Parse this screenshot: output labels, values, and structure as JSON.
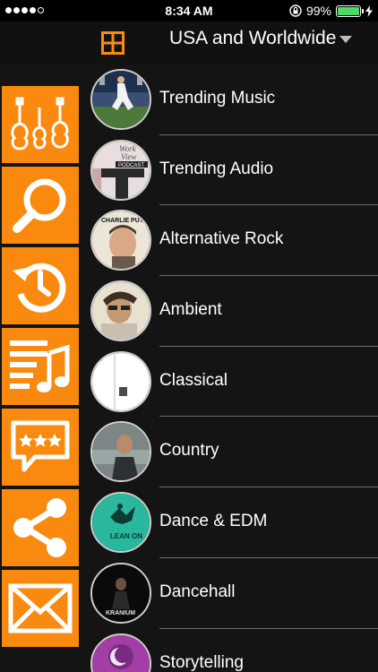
{
  "status_bar": {
    "time": "8:34 AM",
    "battery_percent": "99%",
    "battery_level": 0.99,
    "signal_bars_filled": 4,
    "signal_bars_total": 5
  },
  "header": {
    "region_label": "USA and Worldwide",
    "grid_icon": "grid-icon",
    "accent_color": "#f98a0f"
  },
  "sidebar": {
    "items": [
      {
        "icon": "guitars-icon",
        "name": "guitars"
      },
      {
        "icon": "search-icon",
        "name": "search"
      },
      {
        "icon": "history-icon",
        "name": "history"
      },
      {
        "icon": "playlist-icon",
        "name": "playlist"
      },
      {
        "icon": "rating-chat-icon",
        "name": "rate"
      },
      {
        "icon": "share-icon",
        "name": "share"
      },
      {
        "icon": "mail-icon",
        "name": "mail"
      }
    ]
  },
  "genres": [
    {
      "label": "Trending Music"
    },
    {
      "label": "Trending Audio",
      "thumb_text_1": "Work",
      "thumb_text_2": "View",
      "thumb_text_3": "PODCAST"
    },
    {
      "label": "Alternative Rock",
      "thumb_text_1": "CHARLIE PUTH"
    },
    {
      "label": "Ambient"
    },
    {
      "label": "Classical"
    },
    {
      "label": "Country"
    },
    {
      "label": "Dance & EDM",
      "thumb_text_1": "LEAN ON"
    },
    {
      "label": "Dancehall",
      "thumb_text_1": "KRANIUM"
    },
    {
      "label": "Storytelling"
    }
  ]
}
